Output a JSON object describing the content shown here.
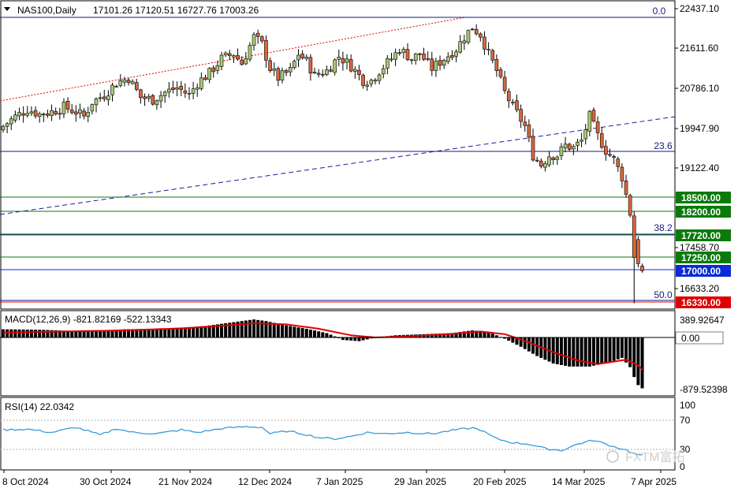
{
  "header": {
    "symbol": "NAS100,Daily",
    "ohlc": "17101.26 17120.51 16727.76 17003.26"
  },
  "price_scale": [
    "22437.10",
    "21611.60",
    "20786.10",
    "19947.90",
    "19122.40",
    "17458.70",
    "16633.20"
  ],
  "fib_labels": [
    "0.0",
    "23.6",
    "38.2",
    "50.0"
  ],
  "levels": [
    {
      "label": "18500.00",
      "color": "#0b7a0b"
    },
    {
      "label": "18200.00",
      "color": "#0b7a0b"
    },
    {
      "label": "17720.00",
      "color": "#0b7a0b"
    },
    {
      "label": "17250.00",
      "color": "#0b7a0b"
    },
    {
      "label": "17000.00",
      "color": "#0a2bd6"
    },
    {
      "label": "16330.00",
      "color": "#e00000"
    }
  ],
  "macd": {
    "title": "MACD(12,26,9) -821.82169 -522.13343",
    "scale": [
      "389.92647",
      "0.00",
      "-879.52398"
    ]
  },
  "rsi": {
    "title": "RSI(14) 22.0342",
    "scale": [
      "100",
      "70",
      "30",
      "0"
    ]
  },
  "x_axis": [
    "8 Oct 2024",
    "30 Oct 2024",
    "21 Nov 2024",
    "12 Dec 2024",
    "7 Jan 2025",
    "29 Jan 2025",
    "20 Feb 2025",
    "14 Mar 2025",
    "7 Apr 2025"
  ],
  "watermark": "FXTM富拓",
  "colors": {
    "bull": "#a8c878",
    "bear": "#d9673b",
    "signal": "#e00000",
    "rsi": "#3a9ad9"
  },
  "chart_data": {
    "type": "candlestick",
    "symbol": "NAS100",
    "timeframe": "Daily",
    "x_ticks": [
      "8 Oct 2024",
      "30 Oct 2024",
      "21 Nov 2024",
      "12 Dec 2024",
      "7 Jan 2025",
      "29 Jan 2025",
      "20 Feb 2025",
      "14 Mar 2025",
      "7 Apr 2025"
    ],
    "close_path": [
      [
        0,
        20000
      ],
      [
        3,
        20200
      ],
      [
        6,
        20350
      ],
      [
        9,
        20250
      ],
      [
        12,
        20300
      ],
      [
        15,
        20400
      ],
      [
        18,
        20300
      ],
      [
        20,
        20200
      ],
      [
        22,
        20500
      ],
      [
        25,
        20650
      ],
      [
        28,
        20900
      ],
      [
        31,
        21000
      ],
      [
        34,
        20600
      ],
      [
        37,
        20550
      ],
      [
        40,
        20700
      ],
      [
        43,
        20800
      ],
      [
        46,
        20650
      ],
      [
        48,
        20900
      ],
      [
        51,
        21100
      ],
      [
        54,
        21400
      ],
      [
        57,
        21500
      ],
      [
        59,
        21300
      ],
      [
        62,
        21850
      ],
      [
        64,
        21700
      ],
      [
        66,
        21200
      ],
      [
        68,
        21000
      ],
      [
        71,
        21150
      ],
      [
        73,
        21500
      ],
      [
        75,
        21350
      ],
      [
        77,
        21050
      ],
      [
        80,
        21150
      ],
      [
        83,
        21450
      ],
      [
        86,
        21250
      ],
      [
        89,
        20950
      ],
      [
        91,
        20950
      ],
      [
        93,
        21150
      ],
      [
        96,
        21400
      ],
      [
        98,
        21600
      ],
      [
        101,
        21400
      ],
      [
        103,
        21500
      ],
      [
        106,
        21200
      ],
      [
        109,
        21400
      ],
      [
        112,
        21600
      ],
      [
        114,
        21850
      ],
      [
        116,
        22050
      ],
      [
        118,
        21900
      ],
      [
        120,
        21500
      ],
      [
        122,
        21150
      ],
      [
        124,
        20700
      ],
      [
        126,
        20400
      ],
      [
        129,
        20000
      ],
      [
        131,
        19400
      ],
      [
        133,
        19200
      ],
      [
        135,
        19400
      ],
      [
        137,
        19400
      ],
      [
        139,
        19600
      ],
      [
        141,
        19550
      ],
      [
        143,
        19700
      ],
      [
        145,
        20200
      ],
      [
        147,
        19800
      ],
      [
        149,
        19500
      ],
      [
        151,
        19300
      ],
      [
        153,
        18950
      ],
      [
        155,
        18200
      ],
      [
        156,
        17300
      ],
      [
        157,
        17200
      ],
      [
        158,
        17000
      ]
    ],
    "price_range": [
      16330,
      22437.1
    ],
    "macd": {
      "params": [
        12,
        26,
        9
      ],
      "main": -821.82169,
      "signal": -522.13343,
      "range": [
        -879.52398,
        389.92647
      ]
    },
    "rsi": {
      "period": 14,
      "value": 22.0342,
      "levels": [
        30,
        70
      ]
    },
    "fibonacci": [
      {
        "label": "0.0",
        "price": 22437.1
      },
      {
        "label": "23.6",
        "price": 19452
      },
      {
        "label": "38.2",
        "price": 17720
      },
      {
        "label": "50.0",
        "price": 16330
      }
    ],
    "horizontal_levels": [
      18500,
      18200,
      17720,
      17250,
      17000,
      16330
    ]
  }
}
